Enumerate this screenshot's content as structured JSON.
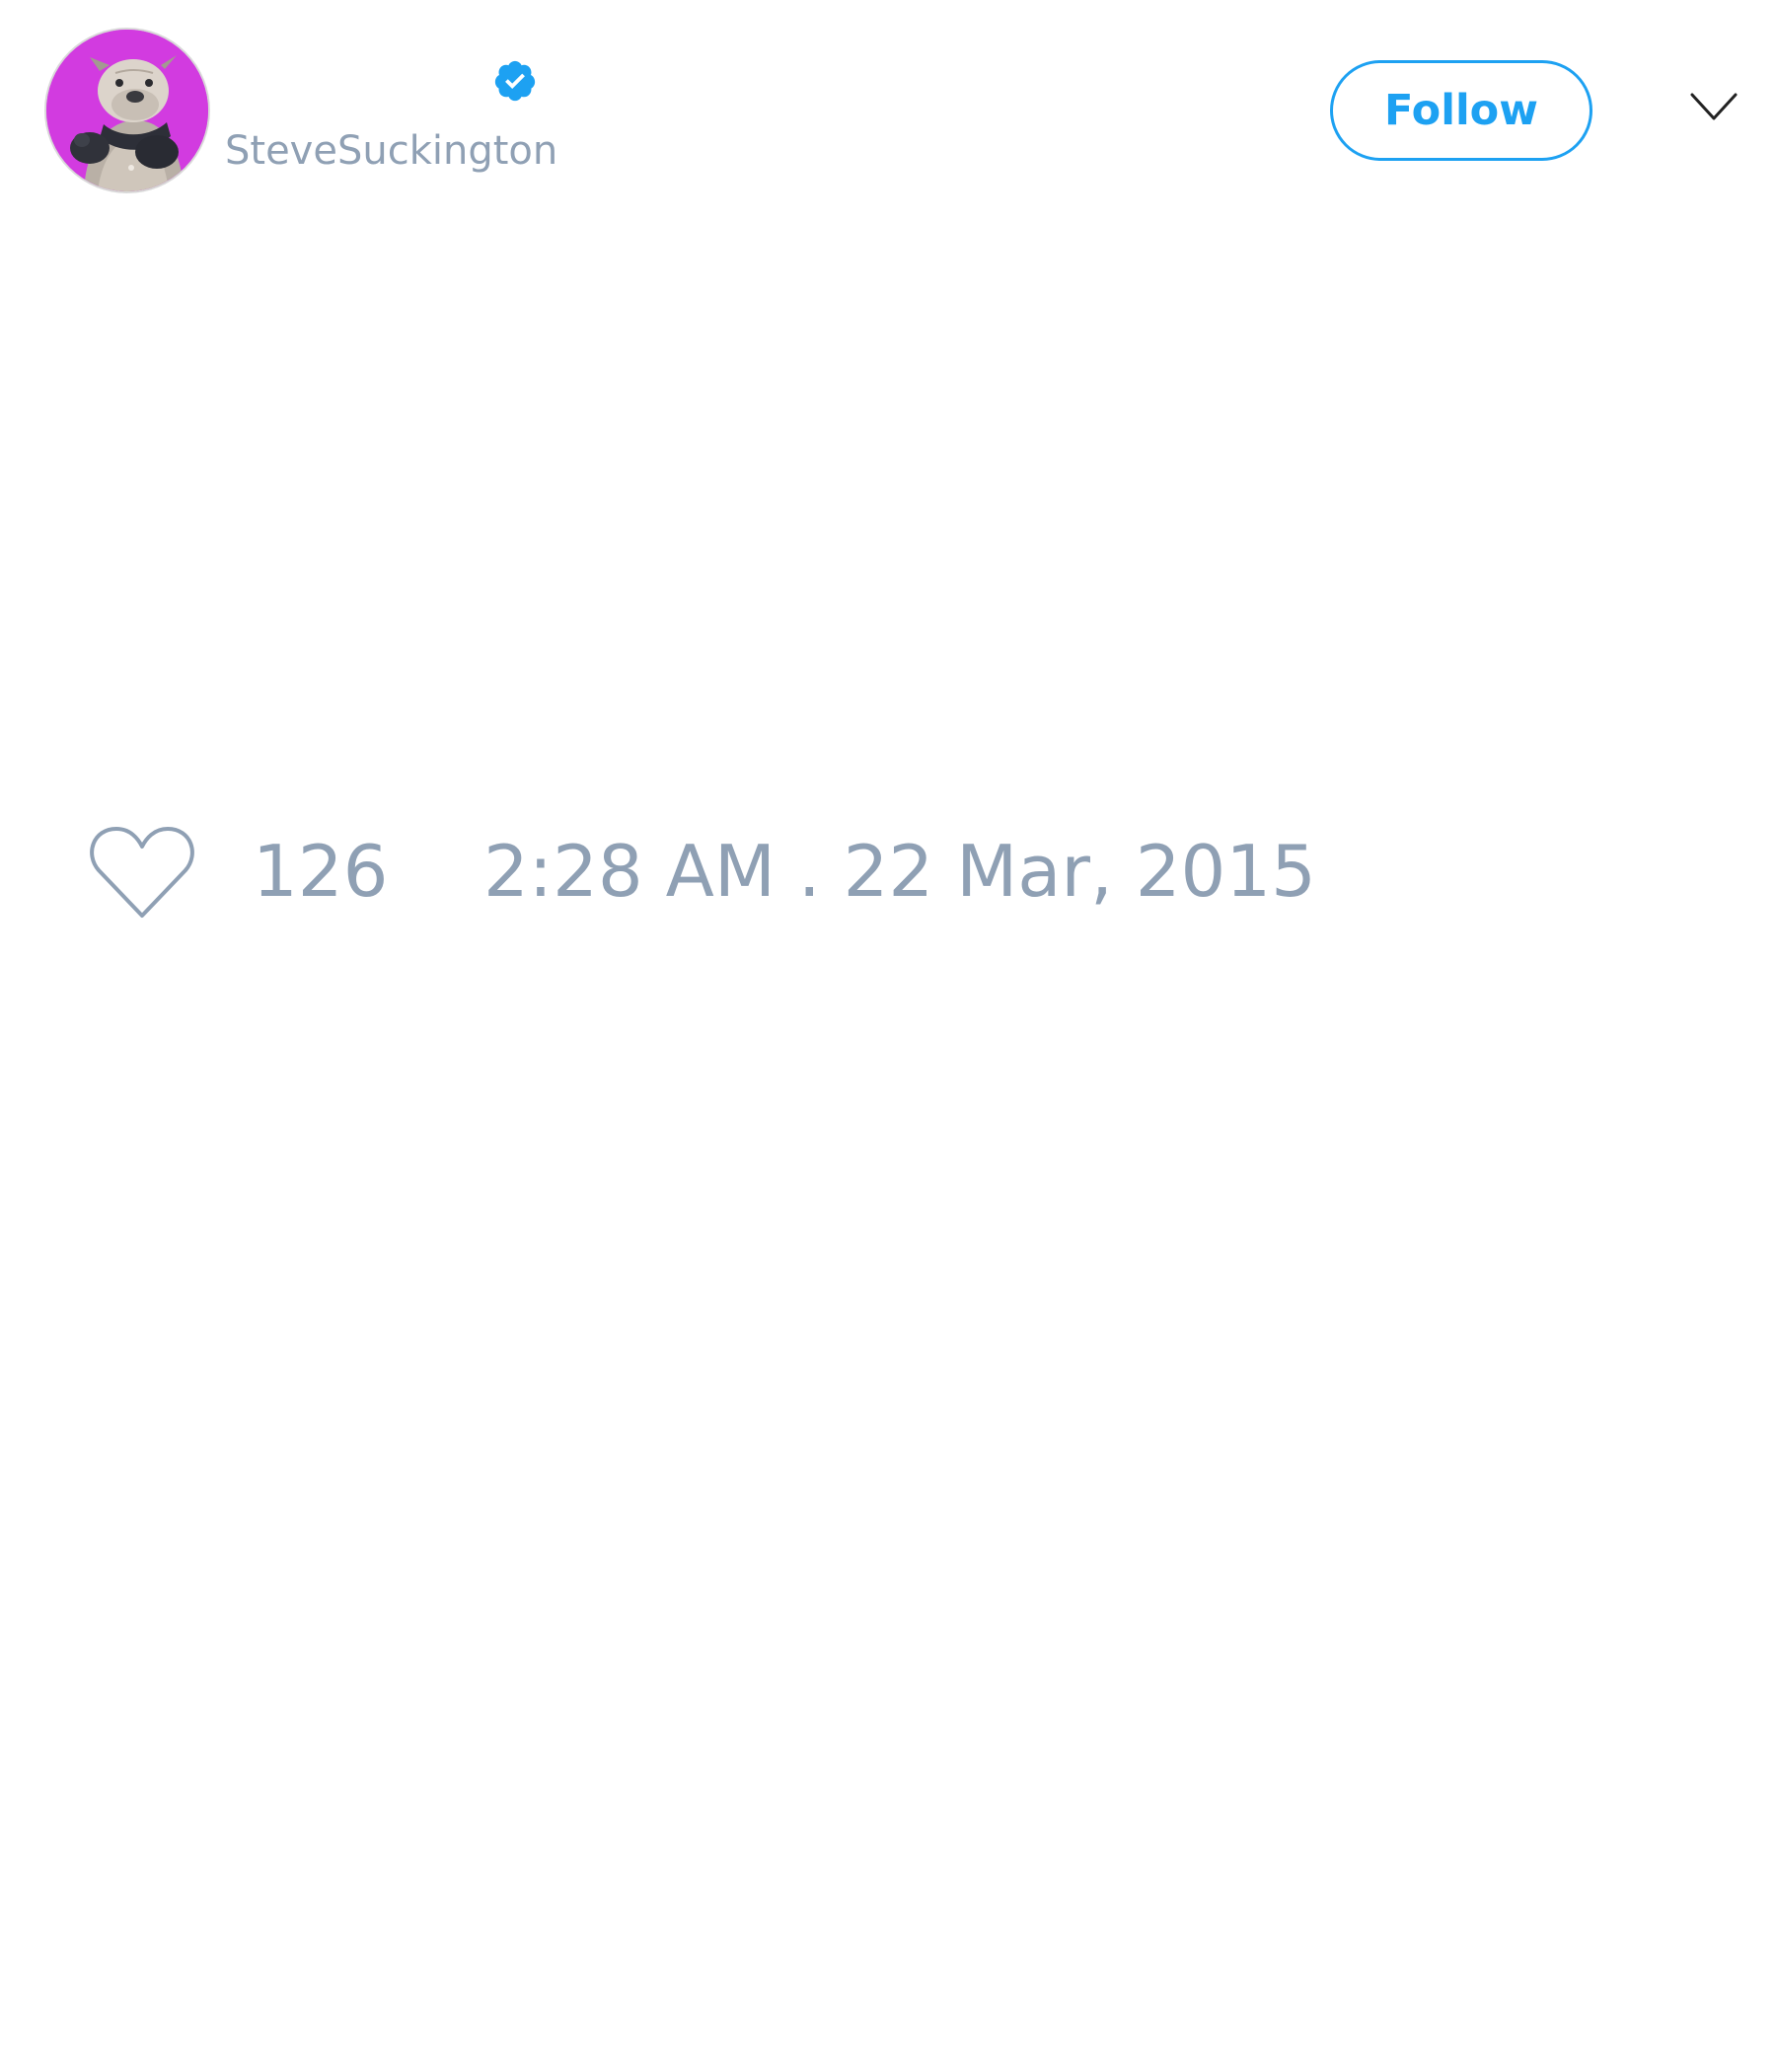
{
  "author": {
    "handle": "SteveSuckington",
    "verified": true,
    "avatar_description": "bulldog in a sweater on purple background"
  },
  "header": {
    "follow_label": "Follow"
  },
  "footer": {
    "like_count": "126",
    "timestamp": "2:28 AM . 22 Mar, 2015"
  },
  "colors": {
    "accent": "#1da1f2",
    "muted_text": "#8fa0b4",
    "avatar_background": "#d23be0"
  },
  "icons": [
    "verified-badge-icon",
    "chevron-down-icon",
    "heart-icon"
  ]
}
